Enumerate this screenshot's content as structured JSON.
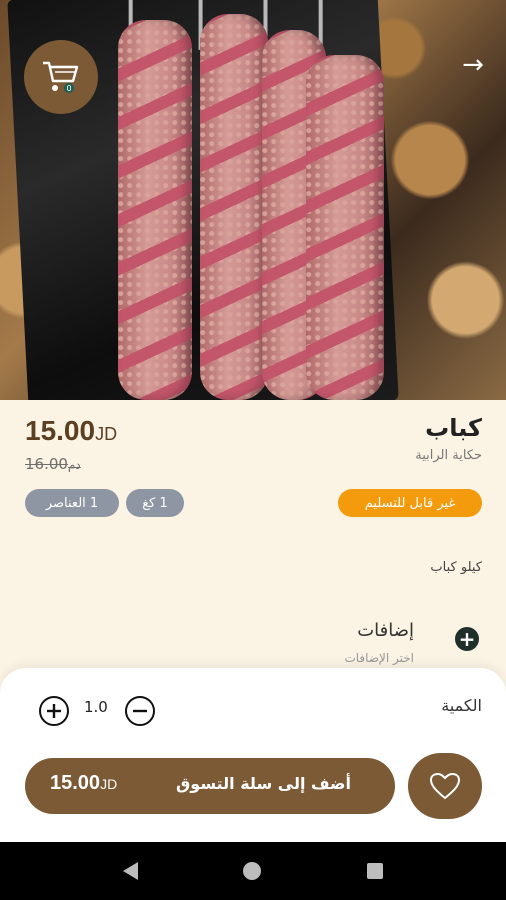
{
  "product": {
    "price": "15.00",
    "currency": "JD",
    "old_price": "16.00",
    "old_currency": "ﺩﻡ",
    "title": "كباب",
    "store": "حكاية الرابية",
    "chips": {
      "items": "1 العناصر",
      "weight": "1 كغ",
      "status": "غير قابل للتسليم"
    },
    "description": "كيلو كباب"
  },
  "addons": {
    "title": "إضافات",
    "subtitle": "اختر الإضافات"
  },
  "sheet": {
    "quantity_label": "الكمية",
    "quantity_value": "1.0",
    "add_label": "أضف إلى سلة التسوق",
    "add_price": "15.00",
    "add_currency": "JD"
  },
  "icons": {
    "cart": "cart-icon",
    "back": "arrow-right-icon",
    "heart": "heart-icon",
    "plus": "plus-circle-icon",
    "minus": "minus-circle-icon"
  },
  "colors": {
    "brand": "#7b5a35",
    "status": "#f39a0d",
    "chip": "#8e96a3",
    "background": "#fbf3e3"
  }
}
